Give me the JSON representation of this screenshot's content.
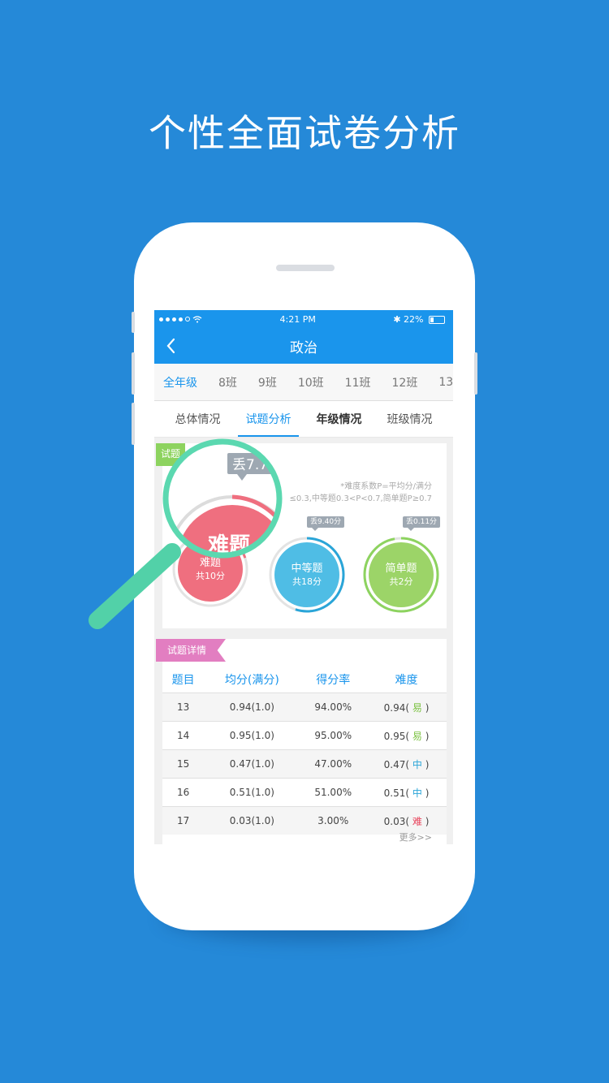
{
  "headline": "个性全面试卷分析",
  "status": {
    "time": "4:21 PM",
    "battery": "22%"
  },
  "nav": {
    "title": "政治"
  },
  "classes": [
    "全年级",
    "8班",
    "9班",
    "10班",
    "11班",
    "12班",
    "13"
  ],
  "tabs": [
    "总体情况",
    "试题分析",
    "年级情况",
    "班级情况"
  ],
  "analysis": {
    "tag": "试题",
    "note_line1": "*难度系数P=平均分/满分",
    "note_line2": "≤0.3,中等题0.3<P<0.7,简单题P≥0.7",
    "loss_big": "丢7.7",
    "circles": [
      {
        "name": "难题",
        "count": "共10分",
        "loss": "",
        "color": "#ef6f7f",
        "ring_color": "#ef6f7f",
        "ring_fraction": 0.2
      },
      {
        "name": "中等题",
        "count": "共18分",
        "loss": "丢9.40分",
        "color": "#4fbde5",
        "ring_color": "#2aa5d8",
        "ring_fraction": 0.55
      },
      {
        "name": "简单题",
        "count": "共2分",
        "loss": "丢0.11分",
        "color": "#9cd468",
        "ring_color": "#8dd35f",
        "ring_fraction": 0.97
      }
    ],
    "magnified_label": "难题"
  },
  "detail": {
    "tag": "试题详情",
    "headers": [
      "题目",
      "均分(满分)",
      "得分率",
      "难度"
    ],
    "rows": [
      {
        "q": "13",
        "avg": "0.94(1.0)",
        "rate": "94.00%",
        "p": "0.94(",
        "level": "易",
        "level_class": "lv-easy"
      },
      {
        "q": "14",
        "avg": "0.95(1.0)",
        "rate": "95.00%",
        "p": "0.95(",
        "level": "易",
        "level_class": "lv-easy"
      },
      {
        "q": "15",
        "avg": "0.47(1.0)",
        "rate": "47.00%",
        "p": "0.47(",
        "level": "中",
        "level_class": "lv-mid"
      },
      {
        "q": "16",
        "avg": "0.51(1.0)",
        "rate": "51.00%",
        "p": "0.51(",
        "level": "中",
        "level_class": "lv-mid"
      },
      {
        "q": "17",
        "avg": "0.03(1.0)",
        "rate": "3.00%",
        "p": "0.03(",
        "level": "难",
        "level_class": "lv-hard"
      }
    ],
    "more": "更多>>"
  },
  "colors": {
    "background": "#2589d8",
    "accent": "#1a95ec",
    "magnifier": "#5bd8b0"
  }
}
